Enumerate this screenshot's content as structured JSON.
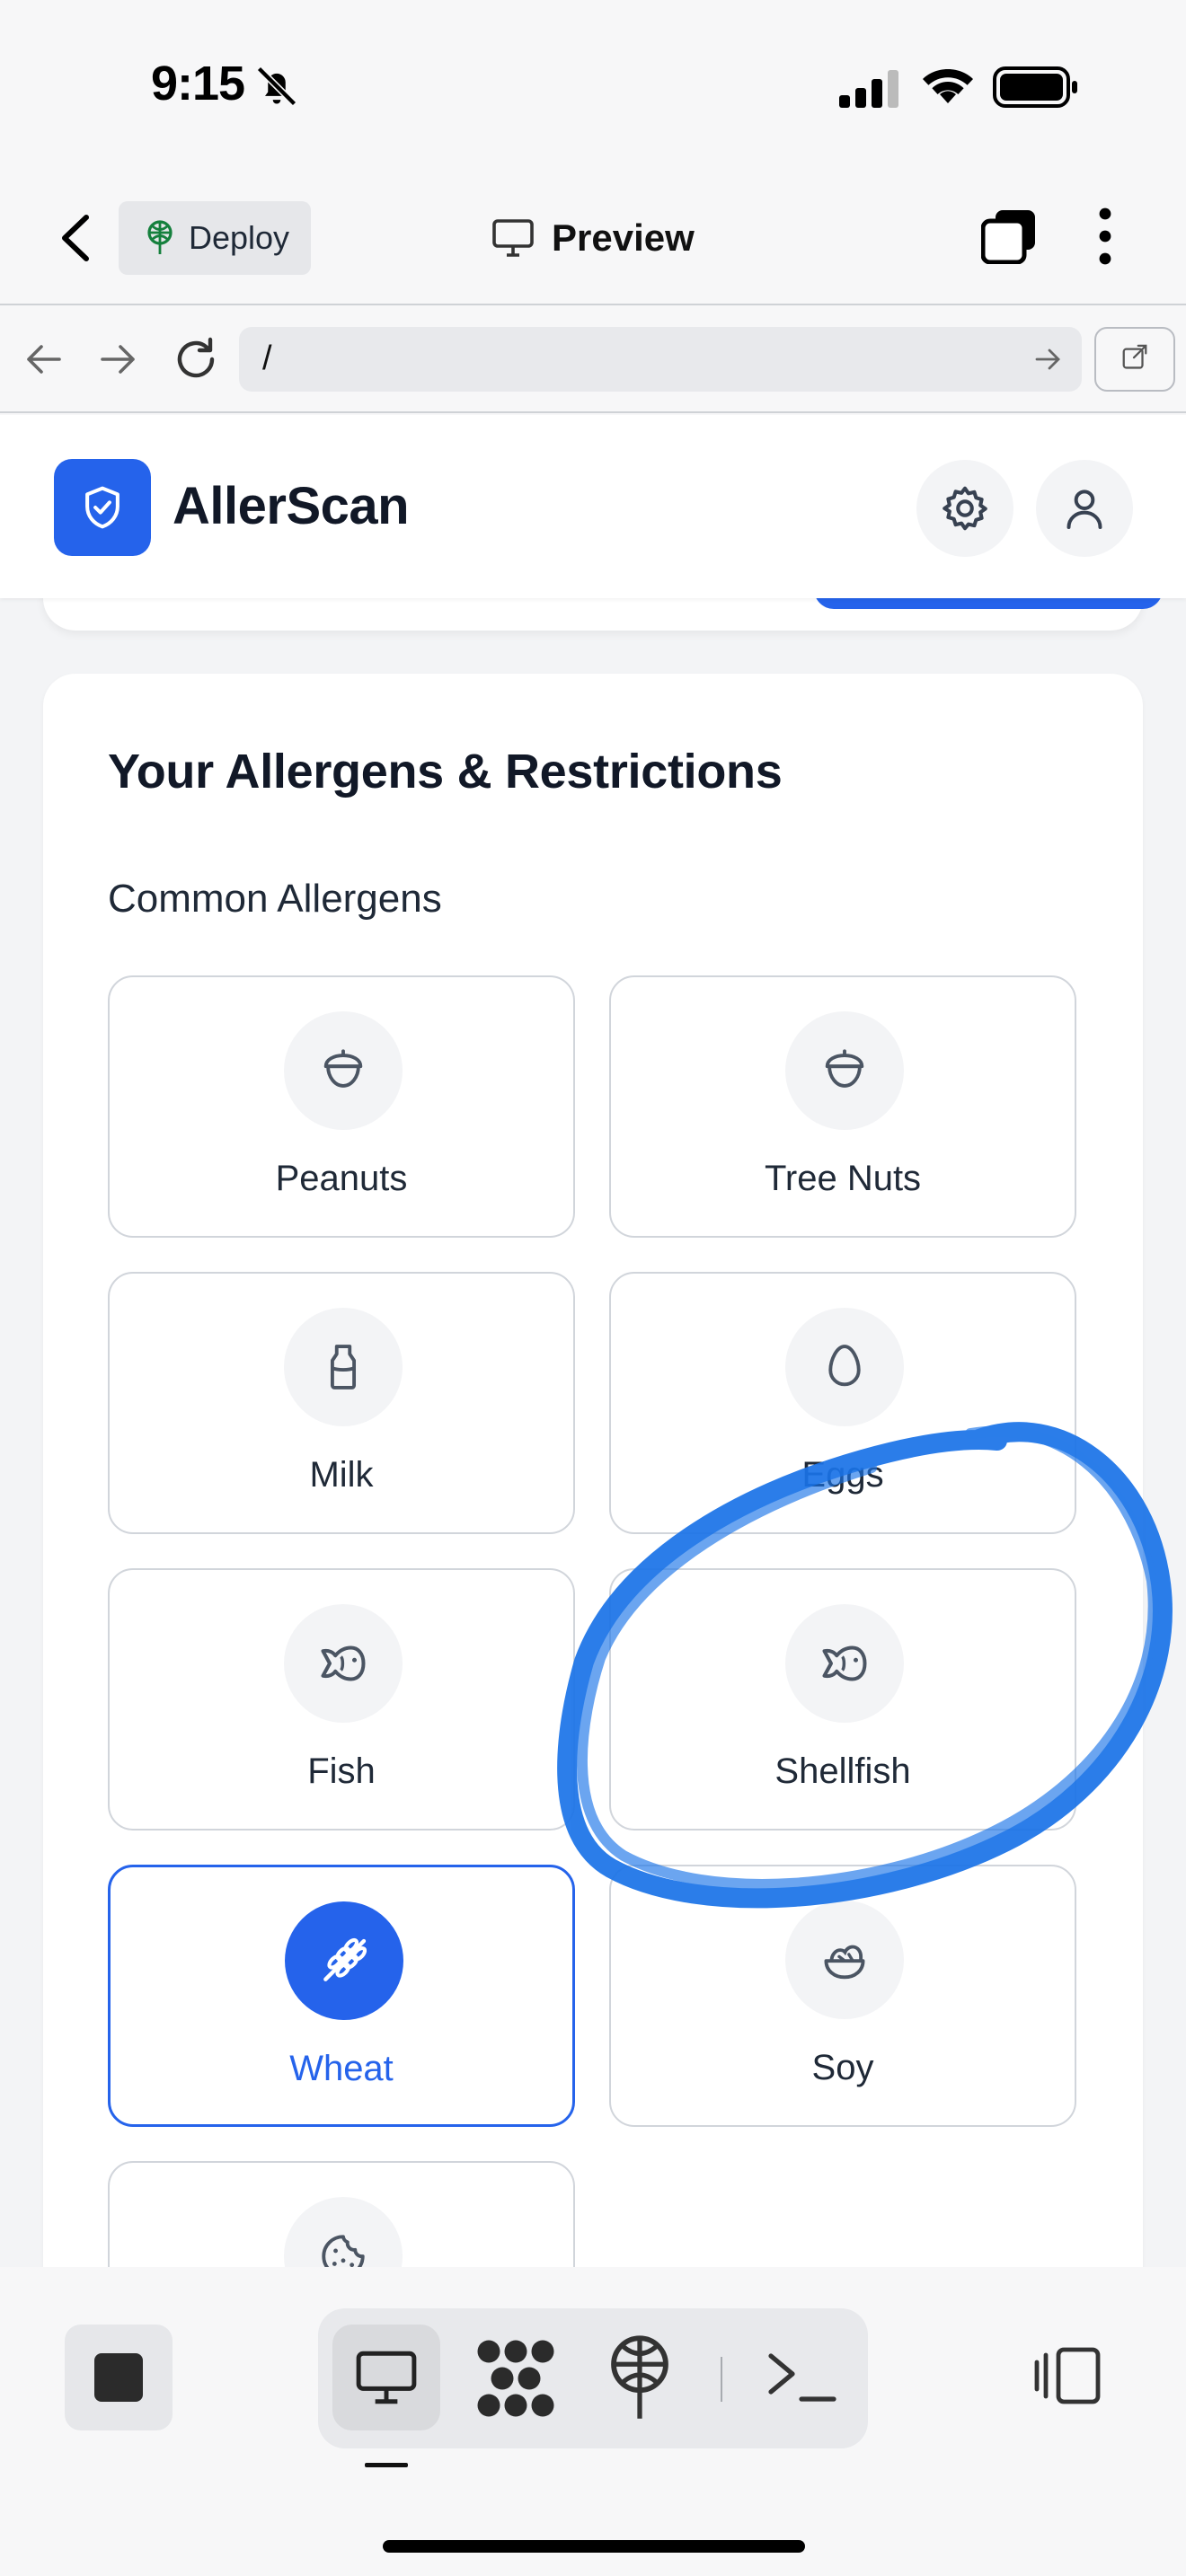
{
  "status_bar": {
    "time": "9:15"
  },
  "toolbar": {
    "deploy_label": "Deploy",
    "preview_label": "Preview"
  },
  "url_bar": {
    "path": "/"
  },
  "app": {
    "title": "AllerScan",
    "brand_color": "#2563eb"
  },
  "allergens": {
    "title": "Your Allergens & Restrictions",
    "section_label": "Common Allergens",
    "items": [
      {
        "label": "Peanuts",
        "icon": "nut-icon",
        "selected": false
      },
      {
        "label": "Tree Nuts",
        "icon": "nut-icon",
        "selected": false
      },
      {
        "label": "Milk",
        "icon": "milk-bottle-icon",
        "selected": false
      },
      {
        "label": "Eggs",
        "icon": "egg-icon",
        "selected": false
      },
      {
        "label": "Fish",
        "icon": "fish-icon",
        "selected": false
      },
      {
        "label": "Shellfish",
        "icon": "fish-icon",
        "selected": false
      },
      {
        "label": "Wheat",
        "icon": "wheat-icon",
        "selected": true
      },
      {
        "label": "Soy",
        "icon": "soy-bowl-icon",
        "selected": false
      },
      {
        "label": "",
        "icon": "cookie-icon",
        "selected": false
      }
    ]
  },
  "annotation": {
    "color": "#1a73e8",
    "target": "Shellfish"
  }
}
